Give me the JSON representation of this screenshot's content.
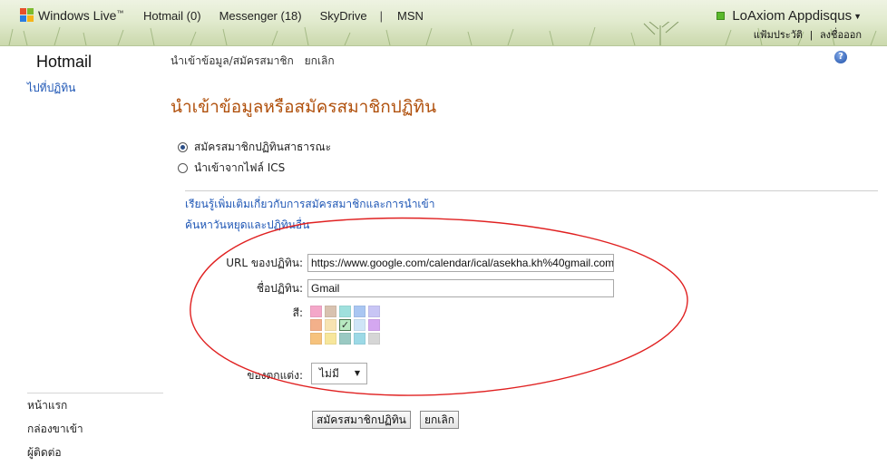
{
  "header": {
    "brand": "Windows Live",
    "brand_tm": "™",
    "nav": [
      {
        "label": "Hotmail (0)"
      },
      {
        "label": "Messenger (18)"
      },
      {
        "label": "SkyDrive"
      },
      {
        "label": "MSN"
      }
    ],
    "account_name": "LoAxiom Appdisqus",
    "account_links": {
      "profile": "แฟ้มประวัติ",
      "sign_out": "ลงชื่อออก"
    }
  },
  "sidebar": {
    "app_title": "Hotmail",
    "goto_calendar": "ไปที่ปฏิทิน",
    "nav": [
      "หน้าแรก",
      "กล่องขาเข้า",
      "ผู้ติดต่อ"
    ]
  },
  "breadcrumb": {
    "current": "นำเข้าข้อมูล/สมัครสมาชิก",
    "cancel": "ยกเลิก"
  },
  "page_title": "นำเข้าข้อมูลหรือสมัครสมาชิกปฏิทิน",
  "options": [
    {
      "label": "สมัครสมาชิกปฏิทินสาธารณะ",
      "selected": true
    },
    {
      "label": "นำเข้าจากไฟล์ ICS",
      "selected": false
    }
  ],
  "links": {
    "learn_more": "เรียนรู้เพิ่มเติมเกี่ยวกับการสมัครสมาชิกและการนำเข้า",
    "find_holidays": "ค้นหาวันหยุดและปฏิทินอื่น"
  },
  "form": {
    "url_label": "URL ของปฏิทิน:",
    "url_value": "https://www.google.com/calendar/ical/asekha.kh%40gmail.com",
    "name_label": "ชื่อปฏิทิน:",
    "name_value": "Gmail",
    "color_label": "สี:",
    "colors": [
      [
        "#f4a7c9",
        "#d8c2b0",
        "#9fe0dd",
        "#a9c6f2",
        "#c8c5f5"
      ],
      [
        "#f3b08a",
        "#f7e3b2",
        "#b8e9c1",
        "#cfe5f7",
        "#d4a7f0"
      ],
      [
        "#f6c27d",
        "#f7e69b",
        "#9ac9c2",
        "#9cd9e6",
        "#d6d6d6"
      ]
    ],
    "selected_color": {
      "row": 1,
      "col": 2,
      "mark": "✓"
    },
    "charm_label": "ของตกแต่ง:",
    "charm_value": "ไม่มี",
    "subscribe_button": "สมัครสมาชิกปฏิทิน",
    "cancel_button": "ยกเลิก"
  },
  "annotation": {
    "color": "#e02020"
  }
}
